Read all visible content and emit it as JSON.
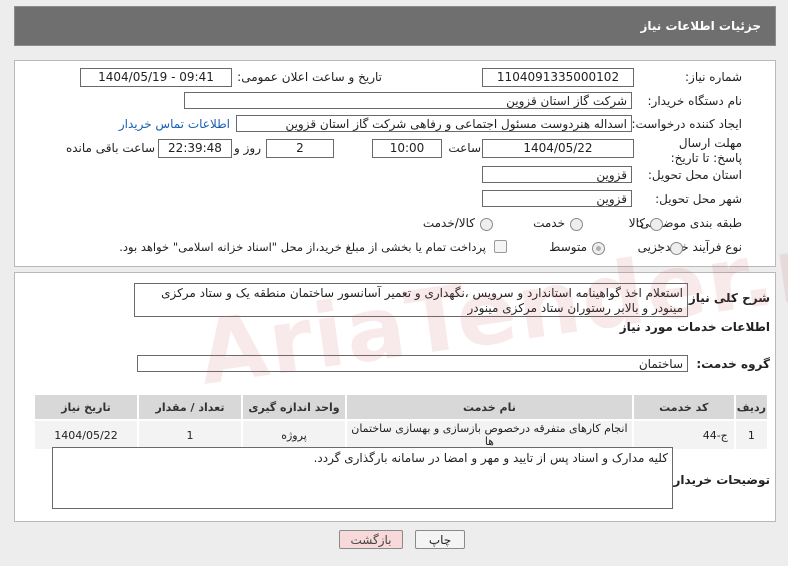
{
  "header": {
    "title": "جزئیات اطلاعات نیاز"
  },
  "form": {
    "need_number_label": "شماره نیاز:",
    "need_number": "1104091335000102",
    "announce_label": "تاریخ و ساعت اعلان عمومی:",
    "announce_value": "1404/05/19 - 09:41",
    "buyer_org_label": "نام دستگاه خریدار:",
    "buyer_org": "شرکت گاز استان قزوین",
    "creator_label": "ایجاد کننده درخواست:",
    "creator": "اسداله هنردوست مسئول اجتماعی و رفاهی شرکت گاز استان قزوین",
    "contact_link": "اطلاعات تماس خریدار",
    "deadline_label": "مهلت ارسال پاسخ: تا تاریخ:",
    "deadline_date": "1404/05/22",
    "time_label": "ساعت",
    "deadline_time": "10:00",
    "days_value": "2",
    "days_label": "روز و",
    "remaining_time": "22:39:48",
    "remaining_label": "ساعت باقی مانده",
    "province_label": "استان محل تحویل:",
    "province": "قزوین",
    "city_label": "شهر محل تحویل:",
    "city": "قزوین",
    "category_label": "طبقه بندی موضوعی:",
    "category_options": [
      "کالا",
      "خدمت",
      "کالا/خدمت"
    ],
    "purchase_type_label": "نوع فرآیند خرید :",
    "purchase_options": [
      "جزیی",
      "متوسط"
    ],
    "payment_note": "پرداخت تمام یا بخشی از مبلغ خرید،از محل \"اسناد خزانه اسلامی\" خواهد بود."
  },
  "summary": {
    "label": "شرح کلی نیاز:",
    "text": "استعلام اخذ گواهینامه استاندارد و سرویس ،نگهداری و تعمیر آسانسور ساختمان منطقه یک و ستاد مرکزی مینودر و بالابر رستوران ستاد مرکزی مینودر"
  },
  "services": {
    "section_title": "اطلاعات خدمات مورد نیاز",
    "group_label": "گروه خدمت:",
    "group_value": "ساختمان",
    "columns": [
      "ردیف",
      "کد خدمت",
      "نام خدمت",
      "واحد اندازه گیری",
      "تعداد / مقدار",
      "تاریخ نیاز"
    ],
    "rows": [
      {
        "row": "1",
        "code": "ج-44",
        "name": "انجام کارهای متفرقه درخصوص بازسازی و بهسازی ساختمان ها",
        "unit": "پروژه",
        "qty": "1",
        "date": "1404/05/22"
      }
    ]
  },
  "buyer_notes": {
    "label": "توضیحات خریدار:",
    "text": "کلیه مدارک و اسناد پس از تایید و مهر و امضا در سامانه بارگذاری گردد."
  },
  "buttons": {
    "print": "چاپ",
    "back": "بازگشت"
  },
  "watermark": "AriaTender.net"
}
